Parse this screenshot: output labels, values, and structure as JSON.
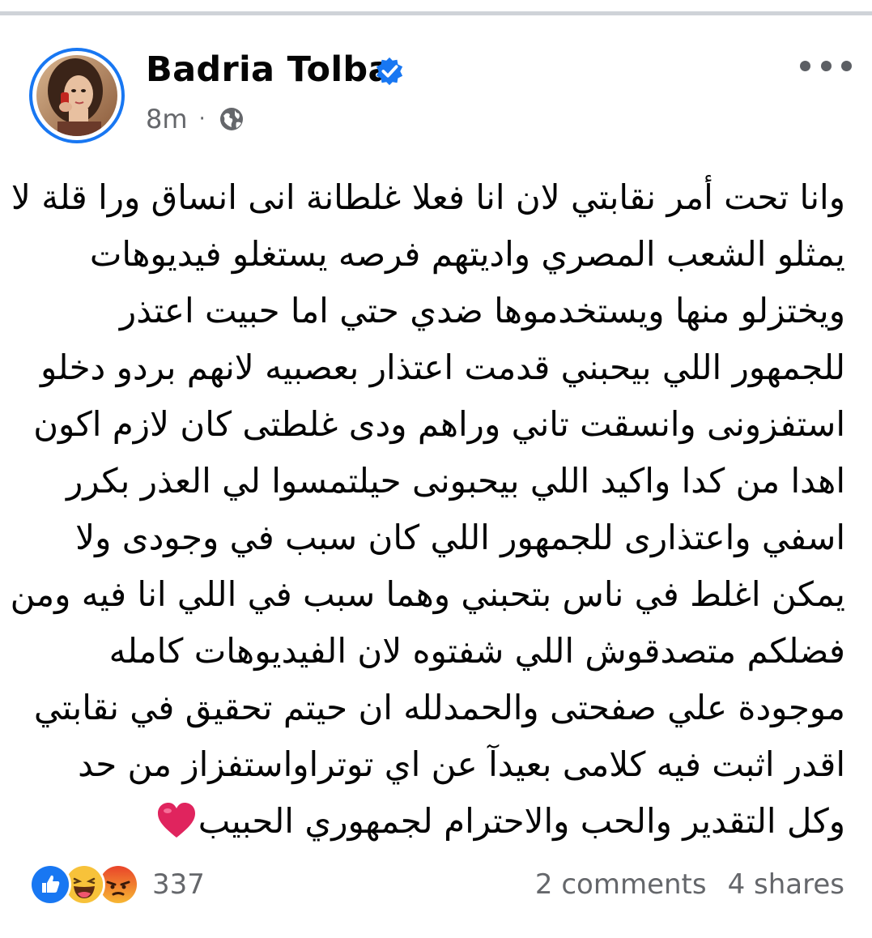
{
  "post": {
    "author": "Badria Tolba",
    "time": "8m",
    "separator": "·",
    "privacy_icon": "globe-icon",
    "verified_icon": "verified-badge-icon",
    "lines": [
      "وانا تحت أمر نقابتي لان انا فعلا غلطانة انى انساق ورا قلة لا",
      "يمثلو الشعب المصري واديتهم فرصه يستغلو فيديوهات",
      "ويختزلو منها ويستخدموها ضدي حتي اما حبيت اعتذر",
      "للجمهور اللي بيحبني قدمت اعتذار بعصبيه لانهم بردو دخلو",
      "استفزونى وانسقت تاني وراهم ودى غلطتى كان لازم اكون",
      "اهدا من كدا واكيد اللي بيحبونى حيلتمسوا لي العذر بكرر",
      "اسفي واعتذارى للجمهور اللي كان سبب في وجودى ولا",
      "يمكن اغلط في ناس بتحبني وهما سبب في اللي انا فيه ومن",
      "فضلكم متصدقوش اللي شفتوه لان الفيديوهات كامله",
      "موجودة علي صفحتى والحمدلله ان حيتم تحقيق في نقابتي",
      "اقدر اثبت فيه كلامى بعيدآ عن اي توتراواستفزاز من حد",
      "وكل التقدير والحب والاحترام لجمهوري الحبيب"
    ],
    "end_emoji": "red-heart-icon"
  },
  "footer": {
    "reactions": [
      "like-reaction-icon",
      "haha-reaction-icon",
      "angry-reaction-icon"
    ],
    "reaction_count": "337",
    "comments": "2 comments",
    "shares": "4 shares"
  },
  "colors": {
    "facebook_blue": "#1877f2",
    "secondary_text": "#65676b",
    "primary_text": "#050505",
    "heart_red": "#e0245e"
  }
}
